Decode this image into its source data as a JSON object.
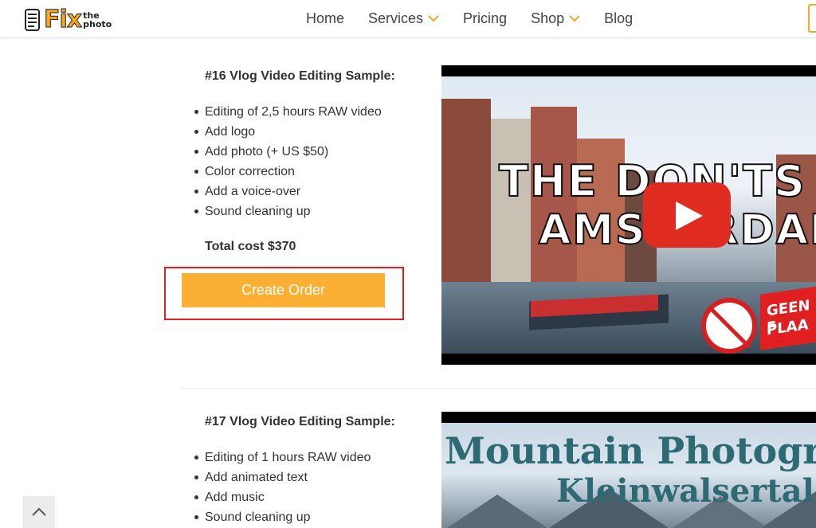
{
  "header": {
    "logo": {
      "fix": "Fix",
      "the": "the",
      "photo": "photo"
    },
    "nav": [
      {
        "label": "Home",
        "dropdown": false
      },
      {
        "label": "Services",
        "dropdown": true
      },
      {
        "label": "Pricing",
        "dropdown": false
      },
      {
        "label": "Shop",
        "dropdown": true
      },
      {
        "label": "Blog",
        "dropdown": false
      }
    ]
  },
  "samples": [
    {
      "title": "#16 Vlog Video Editing Sample:",
      "features": [
        "Editing of 2,5 hours RAW video",
        "Add logo",
        "Add photo (+ US $50)",
        "Color correction",
        "Add a voice-over",
        "Sound cleaning up"
      ],
      "total": "Total cost $370",
      "button": "Create Order",
      "thumbnail": {
        "line1": "THE DON'TS O",
        "line2": "AMSTERDAM",
        "sign1": "GEEN F",
        "sign2": "PLAA"
      }
    },
    {
      "title": "#17 Vlog Video Editing Sample:",
      "features": [
        "Editing of 1 hours RAW video",
        "Add animated text",
        "Add music",
        "Sound cleaning up"
      ],
      "thumbnail": {
        "line1": "Mountain Photogr",
        "line2": "Kleinwalsertal"
      }
    }
  ],
  "colors": {
    "accent": "#fbb034",
    "highlight": "#e02020",
    "youtube": "#e02b20"
  },
  "icons": {
    "scroll_top": "chevron-up-icon",
    "dropdown": "chevron-down-icon",
    "play": "play-icon"
  }
}
